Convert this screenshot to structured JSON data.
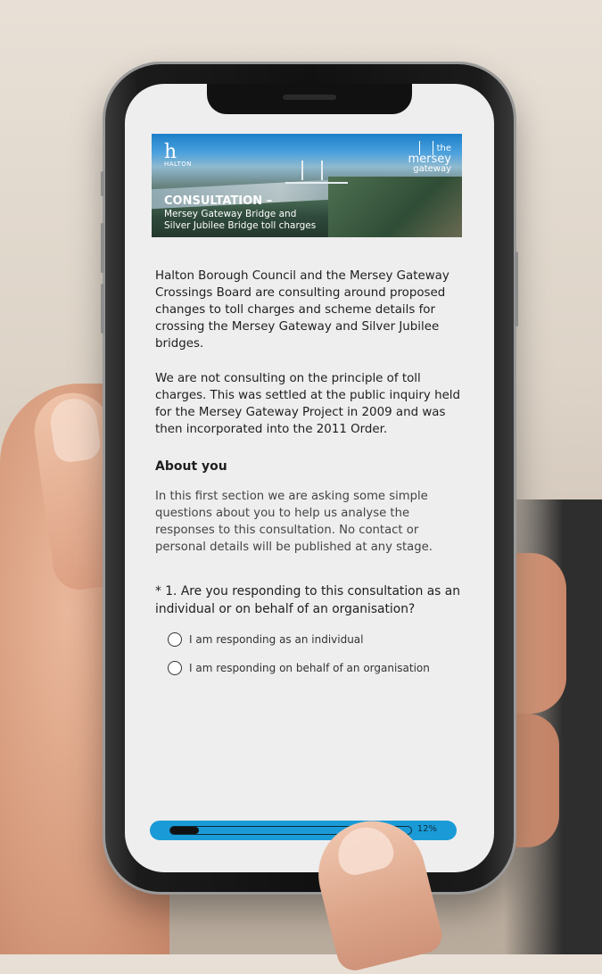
{
  "banner": {
    "logo_left_letter": "h",
    "logo_left_text": "HALTON",
    "logo_right_small": "the",
    "logo_right_big": "mersey",
    "logo_right_sub": "gateway",
    "title": "CONSULTATION –",
    "subtitle_line1": "Mersey Gateway Bridge and",
    "subtitle_line2": "Silver Jubilee Bridge toll charges"
  },
  "intro": {
    "paragraph1": "Halton Borough Council and the Mersey Gateway Crossings Board are consulting around proposed changes to toll charges and scheme details for crossing the Mersey Gateway and Silver Jubilee bridges.",
    "paragraph2": "We are not consulting on the principle of toll charges. This was settled at the public inquiry held for the Mersey Gateway Project in 2009 and was then incorporated into the 2011 Order."
  },
  "about": {
    "title": "About you",
    "description": "In this first section we are asking some simple questions about you to help us analyse the responses to this consultation. No contact or personal details will be published at any stage."
  },
  "question1": {
    "text": "* 1. Are you responding to this consultation as an individual or on behalf of an organisation?",
    "options": [
      "I am responding as an individual",
      "I am responding on behalf of an organisation"
    ]
  },
  "progress": {
    "label": "12%",
    "value": 0.12
  },
  "colors": {
    "accent": "#1a9bd7",
    "screen_bg": "#eeeeee"
  }
}
